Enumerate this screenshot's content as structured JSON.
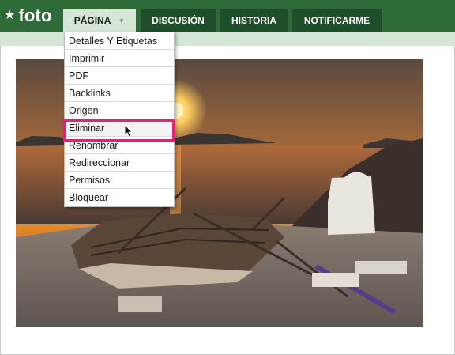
{
  "brand": {
    "star_glyph": "★",
    "name": "foto"
  },
  "tabs": [
    {
      "label": "PÁGINA",
      "active": true
    },
    {
      "label": "DISCUSIÓN",
      "active": false
    },
    {
      "label": "HISTORIA",
      "active": false
    },
    {
      "label": "NOTIFICARME",
      "active": false
    }
  ],
  "menu": {
    "items": [
      "Detalles Y Etiquetas",
      "Imprimir",
      "PDF",
      "Backlinks",
      "Origen",
      "Eliminar",
      "Renombrar",
      "Redireccionar",
      "Permisos",
      "Bloquear"
    ],
    "highlighted_index": 5
  },
  "colors": {
    "topbar": "#2f6b39",
    "tab_inactive": "#1f4f2a",
    "tab_active": "#d4e7d4",
    "highlight_border": "#e0246f"
  },
  "photo": {
    "subject": "sunset-boat-photo"
  }
}
